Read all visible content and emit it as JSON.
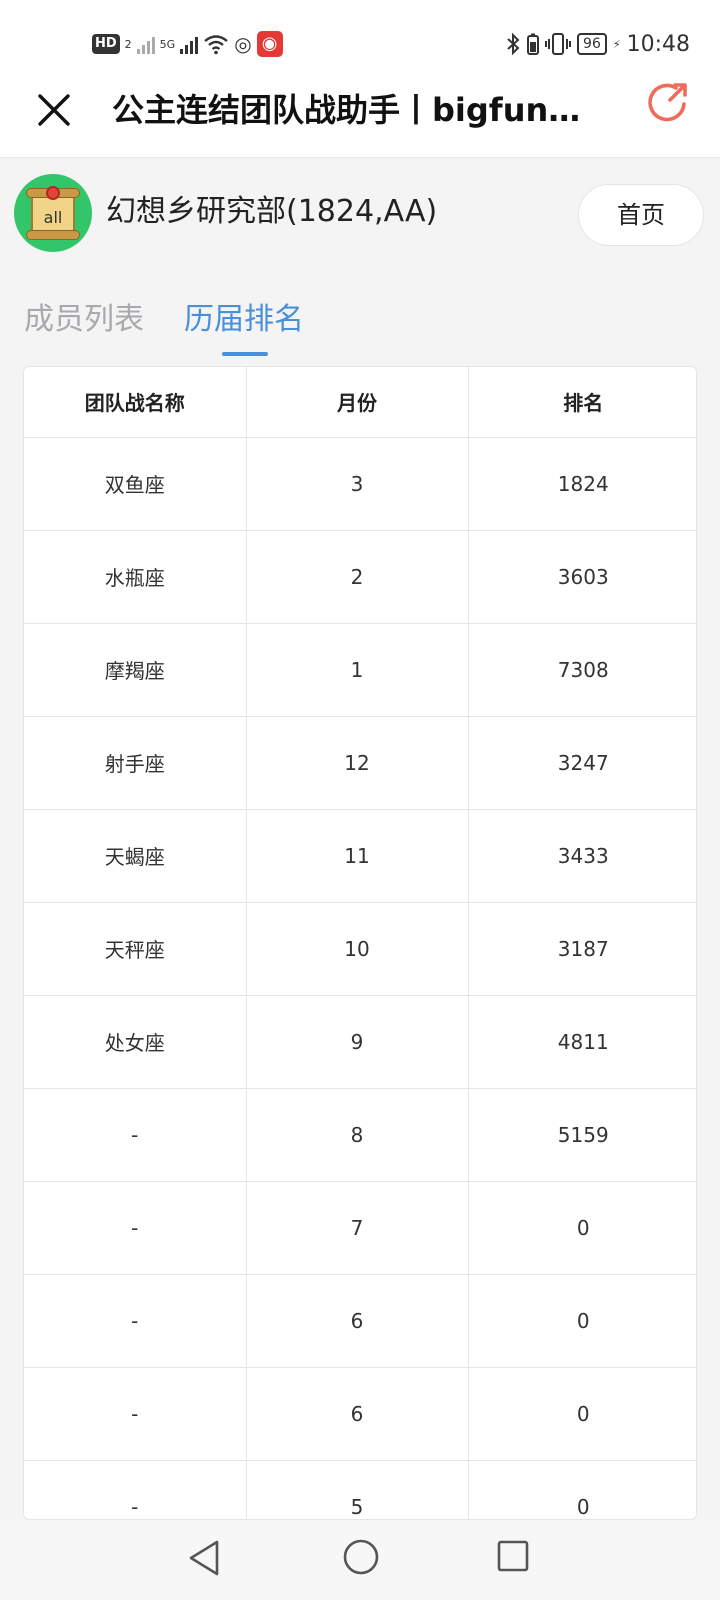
{
  "status_bar": {
    "hd_label": "HD",
    "sim_label": "2",
    "network_label": "5G",
    "battery": "96",
    "time": "10:48"
  },
  "title_bar": {
    "title": "公主连结团队战助手丨bigfun社..."
  },
  "guild": {
    "avatar_text": "all",
    "name": "幻想乡研究部(1824,AA)",
    "home_label": "首页"
  },
  "tabs": [
    {
      "label": "成员列表",
      "active": false
    },
    {
      "label": "历届排名",
      "active": true
    }
  ],
  "table": {
    "headers": [
      "团队战名称",
      "月份",
      "排名"
    ],
    "rows": [
      {
        "name": "双鱼座",
        "month": "3",
        "rank": "1824"
      },
      {
        "name": "水瓶座",
        "month": "2",
        "rank": "3603"
      },
      {
        "name": "摩羯座",
        "month": "1",
        "rank": "7308"
      },
      {
        "name": "射手座",
        "month": "12",
        "rank": "3247"
      },
      {
        "name": "天蝎座",
        "month": "11",
        "rank": "3433"
      },
      {
        "name": "天秤座",
        "month": "10",
        "rank": "3187"
      },
      {
        "name": "处女座",
        "month": "9",
        "rank": "4811"
      },
      {
        "name": "-",
        "month": "8",
        "rank": "5159"
      },
      {
        "name": "-",
        "month": "7",
        "rank": "0"
      },
      {
        "name": "-",
        "month": "6",
        "rank": "0"
      },
      {
        "name": "-",
        "month": "6",
        "rank": "0"
      },
      {
        "name": "-",
        "month": "5",
        "rank": "0"
      }
    ]
  },
  "colors": {
    "accent": "#4a90d9",
    "share_icon": "#ef6b5e",
    "avatar_bg": "#33c56a"
  },
  "icons": {
    "close": "close-icon",
    "share": "share-icon",
    "nav_back": "back-triangle-icon",
    "nav_home": "home-circle-icon",
    "nav_recent": "recent-square-icon"
  }
}
